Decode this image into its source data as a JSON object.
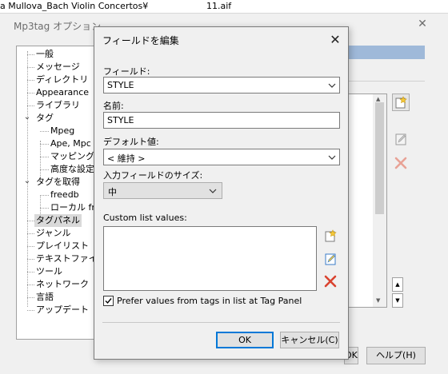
{
  "background": {
    "file_left": "a Mullova_Bach Violin Concertos¥",
    "file_right": "11.aif"
  },
  "options_window": {
    "title": "Mp3tag オプション",
    "close_glyph": "✕",
    "tree": {
      "items": [
        {
          "label": "一般"
        },
        {
          "label": "メッセージ"
        },
        {
          "label": "ディレクトリ"
        },
        {
          "label": "Appearance"
        },
        {
          "label": "ライブラリ"
        },
        {
          "label": "タグ",
          "expander": "⌄"
        },
        {
          "label": "Mpeg"
        },
        {
          "label": "Ape, Mpc ..."
        },
        {
          "label": "マッピング"
        },
        {
          "label": "高度な設定"
        },
        {
          "label": "タグを取得",
          "expander": "⌄"
        },
        {
          "label": "freedb"
        },
        {
          "label": "ローカル fre"
        },
        {
          "label": "タグパネル",
          "selected": true
        },
        {
          "label": "ジャンル"
        },
        {
          "label": "プレイリスト"
        },
        {
          "label": "テキストファイル"
        },
        {
          "label": "ツール"
        },
        {
          "label": "ネットワーク"
        },
        {
          "label": "言語"
        },
        {
          "label": "アップデート"
        }
      ]
    },
    "buttons": {
      "ok_partial": "OK",
      "cancel_partial": "キャンセル(C)",
      "help": "ヘルプ(H)"
    },
    "updown": {
      "up": "▲",
      "down": "▼"
    }
  },
  "dialog": {
    "title": "フィールドを編集",
    "close_glyph": "✕",
    "field_label": "フィールド:",
    "field_value": "STYLE",
    "name_label": "名前:",
    "name_value": "STYLE",
    "default_label": "デフォルト値:",
    "default_value": "< 維持 >",
    "size_label": "入力フィールドのサイズ:",
    "size_value": "中",
    "custom_list_label": "Custom list values:",
    "prefer_label": "Prefer values from tags in list at Tag Panel",
    "prefer_checked": true,
    "check_glyph": "✓",
    "ok_label": "OK",
    "cancel_label": "キャンセル(C)"
  },
  "colors": {
    "accent": "#0078d7",
    "selection_band": "#9fb9d9",
    "delete_red": "#d9432f",
    "new_yellow": "#f5c83a",
    "edit_blue": "#3a7bc8"
  },
  "icons": {
    "new": "new-item-icon",
    "edit": "edit-item-icon",
    "delete": "delete-item-icon",
    "chevron": "chevron-down-icon"
  }
}
